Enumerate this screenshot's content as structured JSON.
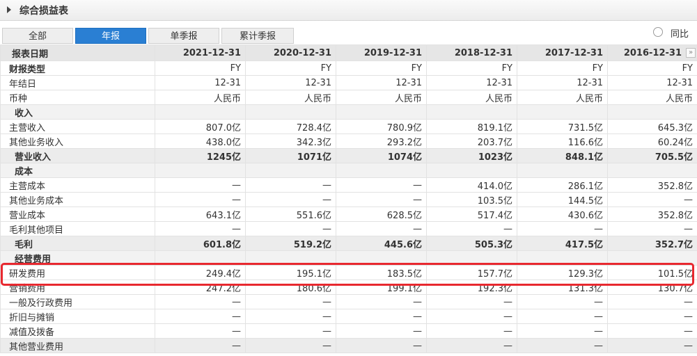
{
  "panel": {
    "title": "综合损益表"
  },
  "tabs": [
    {
      "label": "全部",
      "active": false
    },
    {
      "label": "年报",
      "active": true
    },
    {
      "label": "单季报",
      "active": false
    },
    {
      "label": "累计季报",
      "active": false
    }
  ],
  "yoy_option": {
    "label": "同比",
    "checked": false
  },
  "scroll_icon": "»",
  "table": {
    "header_label": "报表日期",
    "columns": [
      "2021-12-31",
      "2020-12-31",
      "2019-12-31",
      "2018-12-31",
      "2017-12-31",
      "2016-12-31"
    ],
    "rows": [
      {
        "label": "财报类型",
        "type": "bold-label",
        "values": [
          "FY",
          "FY",
          "FY",
          "FY",
          "FY",
          "FY"
        ]
      },
      {
        "label": "年结日",
        "type": "normal",
        "values": [
          "12-31",
          "12-31",
          "12-31",
          "12-31",
          "12-31",
          "12-31"
        ]
      },
      {
        "label": "币种",
        "type": "normal",
        "values": [
          "人民币",
          "人民币",
          "人民币",
          "人民币",
          "人民币",
          "人民币"
        ]
      },
      {
        "label": "收入",
        "type": "section",
        "values": [
          "",
          "",
          "",
          "",
          "",
          ""
        ]
      },
      {
        "label": "主营收入",
        "type": "normal",
        "values": [
          "807.0亿",
          "728.4亿",
          "780.9亿",
          "819.1亿",
          "731.5亿",
          "645.3亿"
        ]
      },
      {
        "label": "其他业务收入",
        "type": "normal",
        "values": [
          "438.0亿",
          "342.3亿",
          "293.2亿",
          "203.7亿",
          "116.6亿",
          "60.24亿"
        ]
      },
      {
        "label": "营业收入",
        "type": "total",
        "values": [
          "1245亿",
          "1071亿",
          "1074亿",
          "1023亿",
          "848.1亿",
          "705.5亿"
        ]
      },
      {
        "label": "成本",
        "type": "section",
        "values": [
          "",
          "",
          "",
          "",
          "",
          ""
        ]
      },
      {
        "label": "主营成本",
        "type": "normal",
        "values": [
          "—",
          "—",
          "—",
          "414.0亿",
          "286.1亿",
          "352.8亿"
        ]
      },
      {
        "label": "其他业务成本",
        "type": "normal",
        "values": [
          "—",
          "—",
          "—",
          "103.5亿",
          "144.5亿",
          "—"
        ]
      },
      {
        "label": "营业成本",
        "type": "normal",
        "values": [
          "643.1亿",
          "551.6亿",
          "628.5亿",
          "517.4亿",
          "430.6亿",
          "352.8亿"
        ]
      },
      {
        "label": "毛利其他项目",
        "type": "normal",
        "values": [
          "—",
          "—",
          "—",
          "—",
          "—",
          "—"
        ]
      },
      {
        "label": "毛利",
        "type": "total",
        "values": [
          "601.8亿",
          "519.2亿",
          "445.6亿",
          "505.3亿",
          "417.5亿",
          "352.7亿"
        ]
      },
      {
        "label": "经营费用",
        "type": "section",
        "values": [
          "",
          "",
          "",
          "",
          "",
          ""
        ]
      },
      {
        "label": "研发费用",
        "type": "normal",
        "values": [
          "249.4亿",
          "195.1亿",
          "183.5亿",
          "157.7亿",
          "129.3亿",
          "101.5亿"
        ]
      },
      {
        "label": "营销费用",
        "type": "normal",
        "values": [
          "247.2亿",
          "180.6亿",
          "199.1亿",
          "192.3亿",
          "131.3亿",
          "130.7亿"
        ]
      },
      {
        "label": "一般及行政费用",
        "type": "normal",
        "values": [
          "—",
          "—",
          "—",
          "—",
          "—",
          "—"
        ]
      },
      {
        "label": "折旧与摊销",
        "type": "normal",
        "values": [
          "—",
          "—",
          "—",
          "—",
          "—",
          "—"
        ]
      },
      {
        "label": "减值及拨备",
        "type": "normal",
        "values": [
          "—",
          "—",
          "—",
          "—",
          "—",
          "—"
        ]
      },
      {
        "label": "其他营业费用",
        "type": "total-plain",
        "values": [
          "—",
          "—",
          "—",
          "—",
          "—",
          "—"
        ]
      }
    ]
  },
  "colors": {
    "tab_active": "#2a7fd3",
    "highlight": "#e8282f"
  }
}
